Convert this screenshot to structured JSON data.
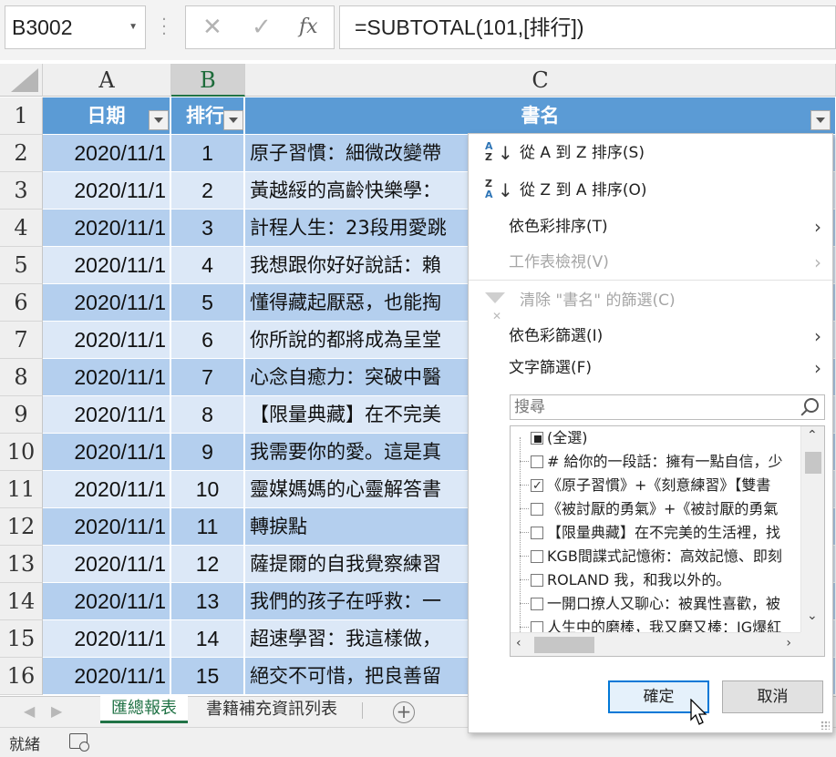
{
  "formula_bar": {
    "name_box": "B3002",
    "cancel_icon": "✕",
    "enter_icon": "✓",
    "fx_label": "fx",
    "formula": "=SUBTOTAL(101,[排行])"
  },
  "columns": {
    "a": "A",
    "b": "B",
    "c": "C"
  },
  "header_row": {
    "row_number": "1",
    "date": "日期",
    "rank": "排行",
    "title": "書名"
  },
  "rows": [
    {
      "n": "2",
      "date": "2020/11/1",
      "rank": "1",
      "title": "原子習慣：細微改變帶"
    },
    {
      "n": "3",
      "date": "2020/11/1",
      "rank": "2",
      "title": "黃越綏的高齡快樂學："
    },
    {
      "n": "4",
      "date": "2020/11/1",
      "rank": "3",
      "title": "計程人生：23段用愛跳"
    },
    {
      "n": "5",
      "date": "2020/11/1",
      "rank": "4",
      "title": "我想跟你好好說話：賴"
    },
    {
      "n": "6",
      "date": "2020/11/1",
      "rank": "5",
      "title": "懂得藏起厭惡，也能掏"
    },
    {
      "n": "7",
      "date": "2020/11/1",
      "rank": "6",
      "title": "你所說的都將成為呈堂"
    },
    {
      "n": "8",
      "date": "2020/11/1",
      "rank": "7",
      "title": "心念自癒力：突破中醫"
    },
    {
      "n": "9",
      "date": "2020/11/1",
      "rank": "8",
      "title": "【限量典藏】在不完美"
    },
    {
      "n": "10",
      "date": "2020/11/1",
      "rank": "9",
      "title": "我需要你的愛。這是真"
    },
    {
      "n": "11",
      "date": "2020/11/1",
      "rank": "10",
      "title": "靈媒媽媽的心靈解答書"
    },
    {
      "n": "12",
      "date": "2020/11/1",
      "rank": "11",
      "title": "轉捩點"
    },
    {
      "n": "13",
      "date": "2020/11/1",
      "rank": "12",
      "title": "薩提爾的自我覺察練習"
    },
    {
      "n": "14",
      "date": "2020/11/1",
      "rank": "13",
      "title": "我們的孩子在呼救：一"
    },
    {
      "n": "15",
      "date": "2020/11/1",
      "rank": "14",
      "title": "超速學習：我這樣做，"
    },
    {
      "n": "16",
      "date": "2020/11/1",
      "rank": "15",
      "title": "絕交不可惜，把良善留"
    }
  ],
  "filter_menu": {
    "sort_az": "從 A 到 Z 排序(S)",
    "sort_za": "從 Z 到 A 排序(O)",
    "sort_by_color": "依色彩排序(T)",
    "sheet_view": "工作表檢視(V)",
    "clear_filter": "清除 \"書名\" 的篩選(C)",
    "filter_by_color": "依色彩篩選(I)",
    "text_filters": "文字篩選(F)",
    "search_placeholder": "搜尋",
    "list_items": [
      {
        "label": "(全選)",
        "state": "partial"
      },
      {
        "label": "# 給你的一段話：擁有一點自信，少",
        "state": "unchecked"
      },
      {
        "label": "《原子習慣》+《刻意練習》【雙書",
        "state": "checked"
      },
      {
        "label": "《被討厭的勇氣》+《被討厭的勇氣",
        "state": "unchecked"
      },
      {
        "label": "【限量典藏】在不完美的生活裡，找",
        "state": "unchecked"
      },
      {
        "label": "KGB間諜式記憶術：高效記憶、即刻",
        "state": "unchecked"
      },
      {
        "label": "ROLAND 我，和我以外的。",
        "state": "unchecked"
      },
      {
        "label": "一開口撩人又聊心：被異性喜歡，被",
        "state": "unchecked"
      },
      {
        "label": "人生中的磨棒，我又磨又棒：IG爆紅",
        "state": "unchecked"
      }
    ],
    "ok_label": "確定",
    "cancel_label": "取消"
  },
  "sheet_tabs": {
    "active": "匯總報表",
    "other": "書籍補充資訊列表",
    "add_icon": "+"
  },
  "status_bar": {
    "text": "就緒"
  },
  "colors": {
    "header_blue": "#5b9bd5",
    "band_dark": "#b4cfee",
    "band_light": "#dce8f7",
    "excel_green": "#217346"
  }
}
